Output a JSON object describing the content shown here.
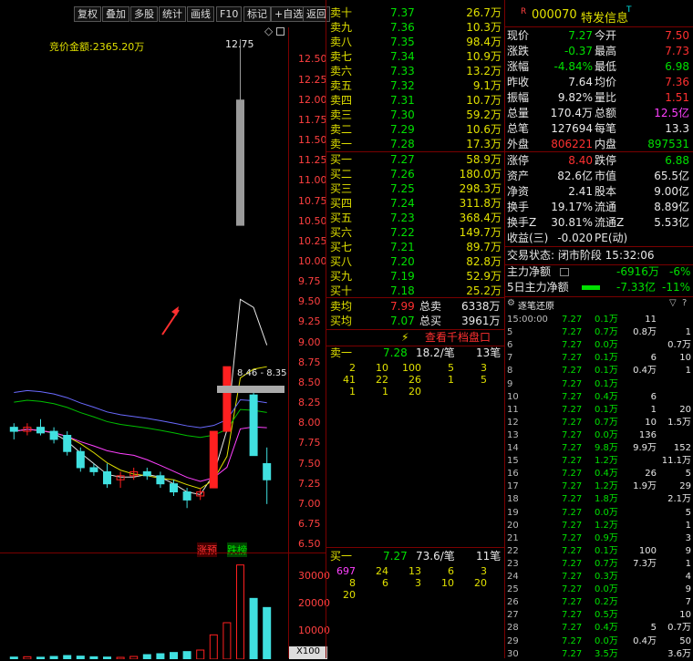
{
  "toolbar": {
    "buttons": [
      "复权",
      "叠加",
      "多股",
      "统计",
      "画线",
      "F10",
      "标记",
      "+自选",
      "返回"
    ]
  },
  "chart": {
    "auction_label": "竞价金额:2365.20万",
    "high_label": "12.75",
    "range_label": "8.46 - 8.35",
    "y_ticks": [
      "12.50",
      "12.25",
      "12.00",
      "11.75",
      "11.50",
      "11.25",
      "11.00",
      "10.75",
      "10.50",
      "10.25",
      "10.00",
      "9.75",
      "9.50",
      "9.25",
      "9.00",
      "8.75",
      "8.50",
      "8.25",
      "8.00",
      "7.75",
      "7.50",
      "7.25",
      "7.00",
      "6.75",
      "6.50"
    ],
    "tag_up": "涨预",
    "tag_down": "跌榜",
    "vol_ticks": [
      "30000",
      "20000",
      "10000"
    ],
    "vol_unit": "X100"
  },
  "chart_data": {
    "type": "candlestick",
    "ylim": [
      6.4,
      12.9
    ],
    "candles": [
      {
        "o": 7.95,
        "h": 8.0,
        "l": 7.8,
        "c": 7.9
      },
      {
        "o": 7.9,
        "h": 8.0,
        "l": 7.85,
        "c": 7.95
      },
      {
        "o": 7.95,
        "h": 8.05,
        "l": 7.85,
        "c": 7.88
      },
      {
        "o": 7.9,
        "h": 7.95,
        "l": 7.75,
        "c": 7.8
      },
      {
        "o": 7.85,
        "h": 7.9,
        "l": 7.6,
        "c": 7.65
      },
      {
        "o": 7.65,
        "h": 7.7,
        "l": 7.4,
        "c": 7.45
      },
      {
        "o": 7.45,
        "h": 7.5,
        "l": 7.35,
        "c": 7.4
      },
      {
        "o": 7.4,
        "h": 7.5,
        "l": 7.2,
        "c": 7.25
      },
      {
        "o": 7.3,
        "h": 7.4,
        "l": 7.2,
        "c": 7.35
      },
      {
        "o": 7.35,
        "h": 7.45,
        "l": 7.3,
        "c": 7.4
      },
      {
        "o": 7.4,
        "h": 7.45,
        "l": 7.3,
        "c": 7.35
      },
      {
        "o": 7.35,
        "h": 7.4,
        "l": 7.2,
        "c": 7.25
      },
      {
        "o": 7.25,
        "h": 7.3,
        "l": 7.1,
        "c": 7.15
      },
      {
        "o": 7.15,
        "h": 7.2,
        "l": 6.95,
        "c": 7.05
      },
      {
        "o": 7.1,
        "h": 7.2,
        "l": 7.05,
        "c": 7.15
      },
      {
        "o": 7.2,
        "h": 7.9,
        "l": 7.2,
        "c": 7.9
      },
      {
        "o": 7.9,
        "h": 8.7,
        "l": 7.9,
        "c": 8.7
      },
      {
        "o": 10.45,
        "h": 12.75,
        "l": 10.45,
        "c": 12.0
      },
      {
        "o": 8.35,
        "h": 8.4,
        "l": 7.6,
        "c": 7.6
      },
      {
        "o": 7.5,
        "h": 7.7,
        "l": 7.0,
        "c": 7.3
      }
    ],
    "volumes": [
      700,
      800,
      650,
      900,
      1200,
      1000,
      800,
      700,
      600,
      900,
      1500,
      1800,
      2200,
      2500,
      3000,
      8000,
      12000,
      31000,
      20000,
      17000
    ]
  },
  "orderbook": {
    "sell": [
      {
        "label": "卖十",
        "price": "7.37",
        "vol": "26.7万"
      },
      {
        "label": "卖九",
        "price": "7.36",
        "vol": "10.3万"
      },
      {
        "label": "卖八",
        "price": "7.35",
        "vol": "98.4万"
      },
      {
        "label": "卖七",
        "price": "7.34",
        "vol": "10.9万"
      },
      {
        "label": "卖六",
        "price": "7.33",
        "vol": "13.2万"
      },
      {
        "label": "卖五",
        "price": "7.32",
        "vol": "9.1万"
      },
      {
        "label": "卖四",
        "price": "7.31",
        "vol": "10.7万"
      },
      {
        "label": "卖三",
        "price": "7.30",
        "vol": "59.2万"
      },
      {
        "label": "卖二",
        "price": "7.29",
        "vol": "10.6万"
      },
      {
        "label": "卖一",
        "price": "7.28",
        "vol": "17.3万"
      }
    ],
    "buy": [
      {
        "label": "买一",
        "price": "7.27",
        "vol": "58.9万"
      },
      {
        "label": "买二",
        "price": "7.26",
        "vol": "180.0万"
      },
      {
        "label": "买三",
        "price": "7.25",
        "vol": "298.3万"
      },
      {
        "label": "买四",
        "price": "7.24",
        "vol": "311.8万"
      },
      {
        "label": "买五",
        "price": "7.23",
        "vol": "368.4万"
      },
      {
        "label": "买六",
        "price": "7.22",
        "vol": "149.7万"
      },
      {
        "label": "买七",
        "price": "7.21",
        "vol": "89.7万"
      },
      {
        "label": "买八",
        "price": "7.20",
        "vol": "82.8万"
      },
      {
        "label": "买九",
        "price": "7.19",
        "vol": "52.9万"
      },
      {
        "label": "买十",
        "price": "7.18",
        "vol": "25.2万"
      }
    ],
    "avg_sell": {
      "label": "卖均",
      "price": "7.99",
      "tlabel": "总卖",
      "vol": "6338万"
    },
    "avg_buy": {
      "label": "买均",
      "price": "7.07",
      "tlabel": "总买",
      "vol": "3961万"
    },
    "qiandang_label": "查看千档盘口",
    "sell1_detail": {
      "label": "卖一",
      "price": "7.28",
      "amt": "18.2/笔",
      "count": "13笔"
    },
    "sell1_orders": [
      [
        "2",
        "10",
        "100",
        "5",
        "3"
      ],
      [
        "41",
        "22",
        "26",
        "1",
        "5"
      ],
      [
        "1",
        "1",
        "20",
        "",
        ""
      ]
    ],
    "buy1_detail": {
      "label": "买一",
      "price": "7.27",
      "amt": "73.6/笔",
      "count": "11笔"
    },
    "buy1_orders": [
      [
        "697",
        "24",
        "13",
        "6",
        "3"
      ],
      [
        "8",
        "6",
        "3",
        "10",
        "20"
      ],
      [
        "20",
        "",
        "",
        "",
        ""
      ]
    ]
  },
  "quote": {
    "code": "000070",
    "name": "特发信息",
    "rows": [
      {
        "l1": "现价",
        "v1": "7.27",
        "l2": "今开",
        "v2": "7.50"
      },
      {
        "l1": "涨跌",
        "v1": "-0.37",
        "l2": "最高",
        "v2": "7.73"
      },
      {
        "l1": "涨幅",
        "v1": "-4.84%",
        "l2": "最低",
        "v2": "6.98"
      },
      {
        "l1": "昨收",
        "v1": "7.64",
        "l2": "均价",
        "v2": "7.36"
      },
      {
        "l1": "振幅",
        "v1": "9.82%",
        "l2": "量比",
        "v2": "1.51"
      },
      {
        "l1": "总量",
        "v1": "170.4万",
        "l2": "总额",
        "v2": "12.5亿"
      },
      {
        "l1": "总笔",
        "v1": "127694",
        "l2": "每笔",
        "v2": "13.3"
      },
      {
        "l1": "外盘",
        "v1": "806221",
        "l2": "内盘",
        "v2": "897531"
      }
    ],
    "rows2": [
      {
        "l1": "涨停",
        "v1": "8.40",
        "l2": "跌停",
        "v2": "6.88"
      },
      {
        "l1": "资产",
        "v1": "82.6亿",
        "l2": "市值",
        "v2": "65.5亿"
      },
      {
        "l1": "净资",
        "v1": "2.41",
        "l2": "股本",
        "v2": "9.00亿"
      },
      {
        "l1": "换手",
        "v1": "19.17%",
        "l2": "流通",
        "v2": "8.89亿"
      },
      {
        "l1": "换手Z",
        "v1": "30.81%",
        "l2": "流通Z",
        "v2": "5.53亿"
      },
      {
        "l1": "收益(三)",
        "v1": "-0.020",
        "l2": "PE(动)",
        "v2": ""
      }
    ],
    "status": "交易状态: 闭市阶段 15:32:06",
    "main_flow_label": "主力净额",
    "main_flow_val": "-6916万",
    "main_flow_pct": "-6%",
    "flow5_label": "5日主力净额",
    "flow5_val": "-7.33亿",
    "flow5_pct": "-11%"
  },
  "trades": {
    "title": "逐笔还原",
    "rows": [
      {
        "t": "15:00:00",
        "p": "7.27",
        "v": "0.1万",
        "a": "11",
        "b": ""
      },
      {
        "t": "5",
        "p": "7.27",
        "v": "0.7万",
        "a": "0.8万",
        "b": "1"
      },
      {
        "t": "6",
        "p": "7.27",
        "v": "0.0万",
        "a": "",
        "b": "0.7万"
      },
      {
        "t": "7",
        "p": "7.27",
        "v": "0.1万",
        "a": "6",
        "b": "10"
      },
      {
        "t": "8",
        "p": "7.27",
        "v": "0.1万",
        "a": "0.4万",
        "b": "1"
      },
      {
        "t": "9",
        "p": "7.27",
        "v": "0.1万",
        "a": "",
        "b": ""
      },
      {
        "t": "10",
        "p": "7.27",
        "v": "0.4万",
        "a": "6",
        "b": ""
      },
      {
        "t": "11",
        "p": "7.27",
        "v": "0.1万",
        "a": "1",
        "b": "20"
      },
      {
        "t": "12",
        "p": "7.27",
        "v": "0.7万",
        "a": "10",
        "b": "1.5万"
      },
      {
        "t": "13",
        "p": "7.27",
        "v": "0.0万",
        "a": "136",
        "b": ""
      },
      {
        "t": "14",
        "p": "7.27",
        "v": "9.8万",
        "a": "9.9万",
        "b": "152"
      },
      {
        "t": "15",
        "p": "7.27",
        "v": "1.2万",
        "a": "",
        "b": "11.1万"
      },
      {
        "t": "16",
        "p": "7.27",
        "v": "0.4万",
        "a": "26",
        "b": "5"
      },
      {
        "t": "17",
        "p": "7.27",
        "v": "1.2万",
        "a": "1.9万",
        "b": "29"
      },
      {
        "t": "18",
        "p": "7.27",
        "v": "1.8万",
        "a": "",
        "b": "2.1万"
      },
      {
        "t": "19",
        "p": "7.27",
        "v": "0.0万",
        "a": "",
        "b": "5"
      },
      {
        "t": "20",
        "p": "7.27",
        "v": "1.2万",
        "a": "",
        "b": "1"
      },
      {
        "t": "21",
        "p": "7.27",
        "v": "0.9万",
        "a": "",
        "b": "3"
      },
      {
        "t": "22",
        "p": "7.27",
        "v": "0.1万",
        "a": "100",
        "b": "9"
      },
      {
        "t": "23",
        "p": "7.27",
        "v": "0.7万",
        "a": "7.3万",
        "b": "1"
      },
      {
        "t": "24",
        "p": "7.27",
        "v": "0.3万",
        "a": "",
        "b": "4"
      },
      {
        "t": "25",
        "p": "7.27",
        "v": "0.0万",
        "a": "",
        "b": "9"
      },
      {
        "t": "26",
        "p": "7.27",
        "v": "0.2万",
        "a": "",
        "b": "7"
      },
      {
        "t": "27",
        "p": "7.27",
        "v": "0.5万",
        "a": "",
        "b": "10"
      },
      {
        "t": "28",
        "p": "7.27",
        "v": "0.4万",
        "a": "5",
        "b": "0.7万"
      },
      {
        "t": "29",
        "p": "7.27",
        "v": "0.0万",
        "a": "0.4万",
        "b": "50"
      },
      {
        "t": "30",
        "p": "7.27",
        "v": "3.5万",
        "a": "",
        "b": "3.6万"
      }
    ]
  }
}
